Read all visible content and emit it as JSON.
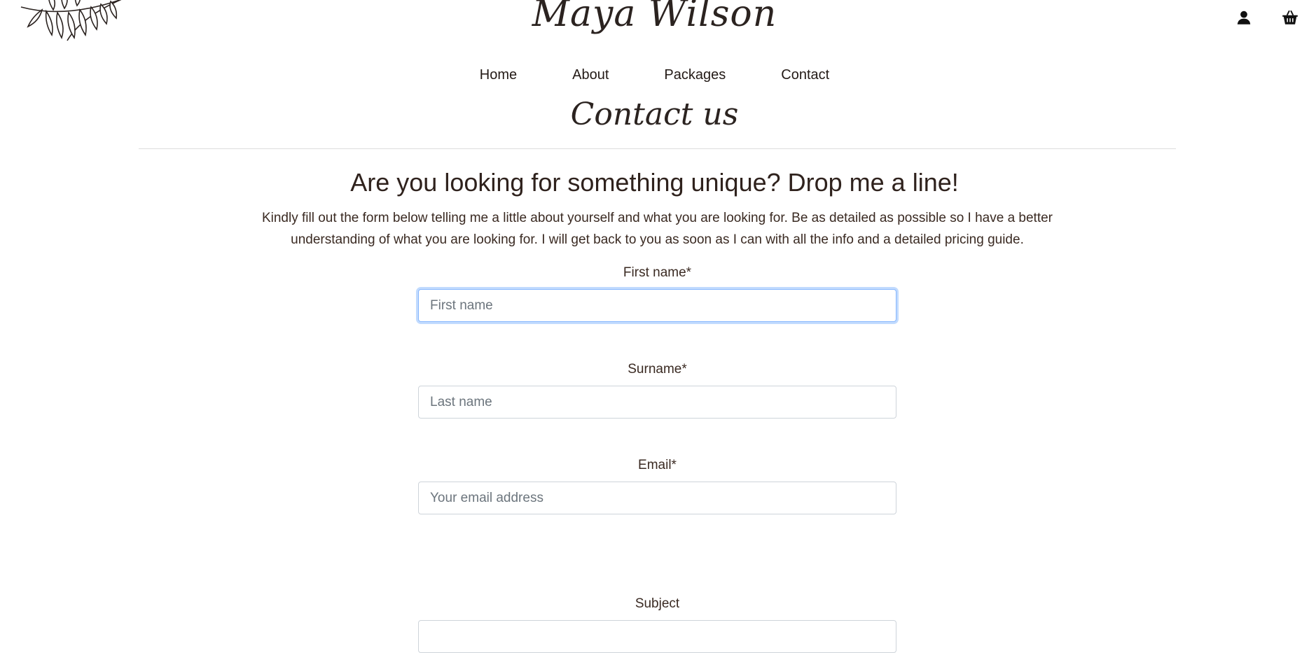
{
  "header": {
    "brand": "Maya Wilson",
    "icons": [
      "account-icon",
      "basket-icon"
    ]
  },
  "nav": {
    "items": [
      "Home",
      "About",
      "Packages",
      "Contact"
    ]
  },
  "page": {
    "heading": "Contact us",
    "intro_title": "Are you looking for something unique? Drop me a line!",
    "intro_text": "Kindly fill out the form below telling me a little about yourself and what you are looking for. Be as detailed as possible so I have a better understanding of what you are looking for. I will get back to you as soon as I can with all the info and a detailed pricing guide."
  },
  "form": {
    "first_name": {
      "label": "First name*",
      "placeholder": "First name",
      "value": ""
    },
    "surname": {
      "label": "Surname*",
      "placeholder": "Last name",
      "value": ""
    },
    "email": {
      "label": "Email*",
      "placeholder": "Your email address",
      "value": ""
    },
    "subject": {
      "label": "Subject"
    }
  },
  "colors": {
    "text": "#3a2a22",
    "input_border": "#ced4da",
    "focus_border": "#86b7fe",
    "divider": "#dddddd"
  }
}
